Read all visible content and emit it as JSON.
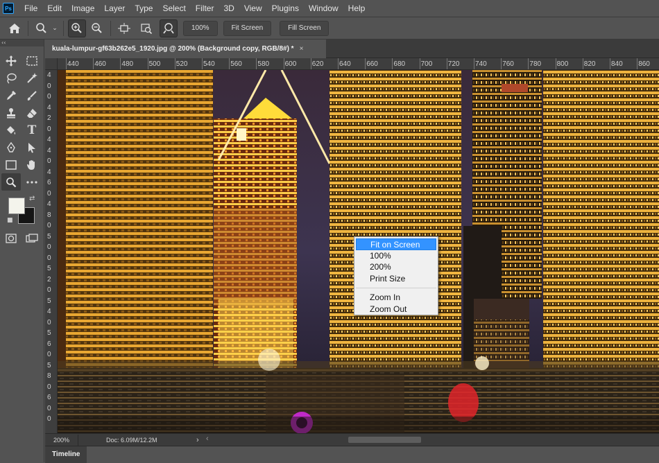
{
  "menubar": {
    "logo": "Ps",
    "items": [
      "File",
      "Edit",
      "Image",
      "Layer",
      "Type",
      "Select",
      "Filter",
      "3D",
      "View",
      "Plugins",
      "Window",
      "Help"
    ]
  },
  "options": {
    "zoom_value": "100%",
    "fit_screen_label": "Fit Screen",
    "fill_screen_label": "Fill Screen"
  },
  "toolbar": {
    "collapse_label": "‹‹"
  },
  "document": {
    "tab_title": "kuala-lumpur-gf63b262e5_1920.jpg @ 200% (Background copy, RGB/8#) *",
    "close_label": "×"
  },
  "ruler": {
    "h_labels": [
      "440",
      "460",
      "480",
      "500",
      "520",
      "540",
      "560",
      "580",
      "600",
      "620",
      "640",
      "660",
      "680",
      "700",
      "720",
      "740",
      "760",
      "780",
      "800",
      "820",
      "840",
      "860"
    ],
    "v_digits": [
      "4",
      "0",
      "0",
      "4",
      "2",
      "0",
      "4",
      "4",
      "0",
      "4",
      "6",
      "0",
      "4",
      "8",
      "0",
      "5",
      "0",
      "0",
      "5",
      "2",
      "0",
      "5",
      "4",
      "0",
      "5",
      "6",
      "0",
      "5",
      "8",
      "0",
      "6",
      "0",
      "0"
    ]
  },
  "status": {
    "zoom": "200%",
    "doc": "Doc: 6.09M/12.2M",
    "arrow": "›",
    "scroll_left": "‹"
  },
  "timeline": {
    "tab_label": "Timeline"
  },
  "context_menu": {
    "items_top": [
      "Fit on Screen",
      "100%",
      "200%",
      "Print Size"
    ],
    "items_bottom": [
      "Zoom In",
      "Zoom Out"
    ]
  }
}
